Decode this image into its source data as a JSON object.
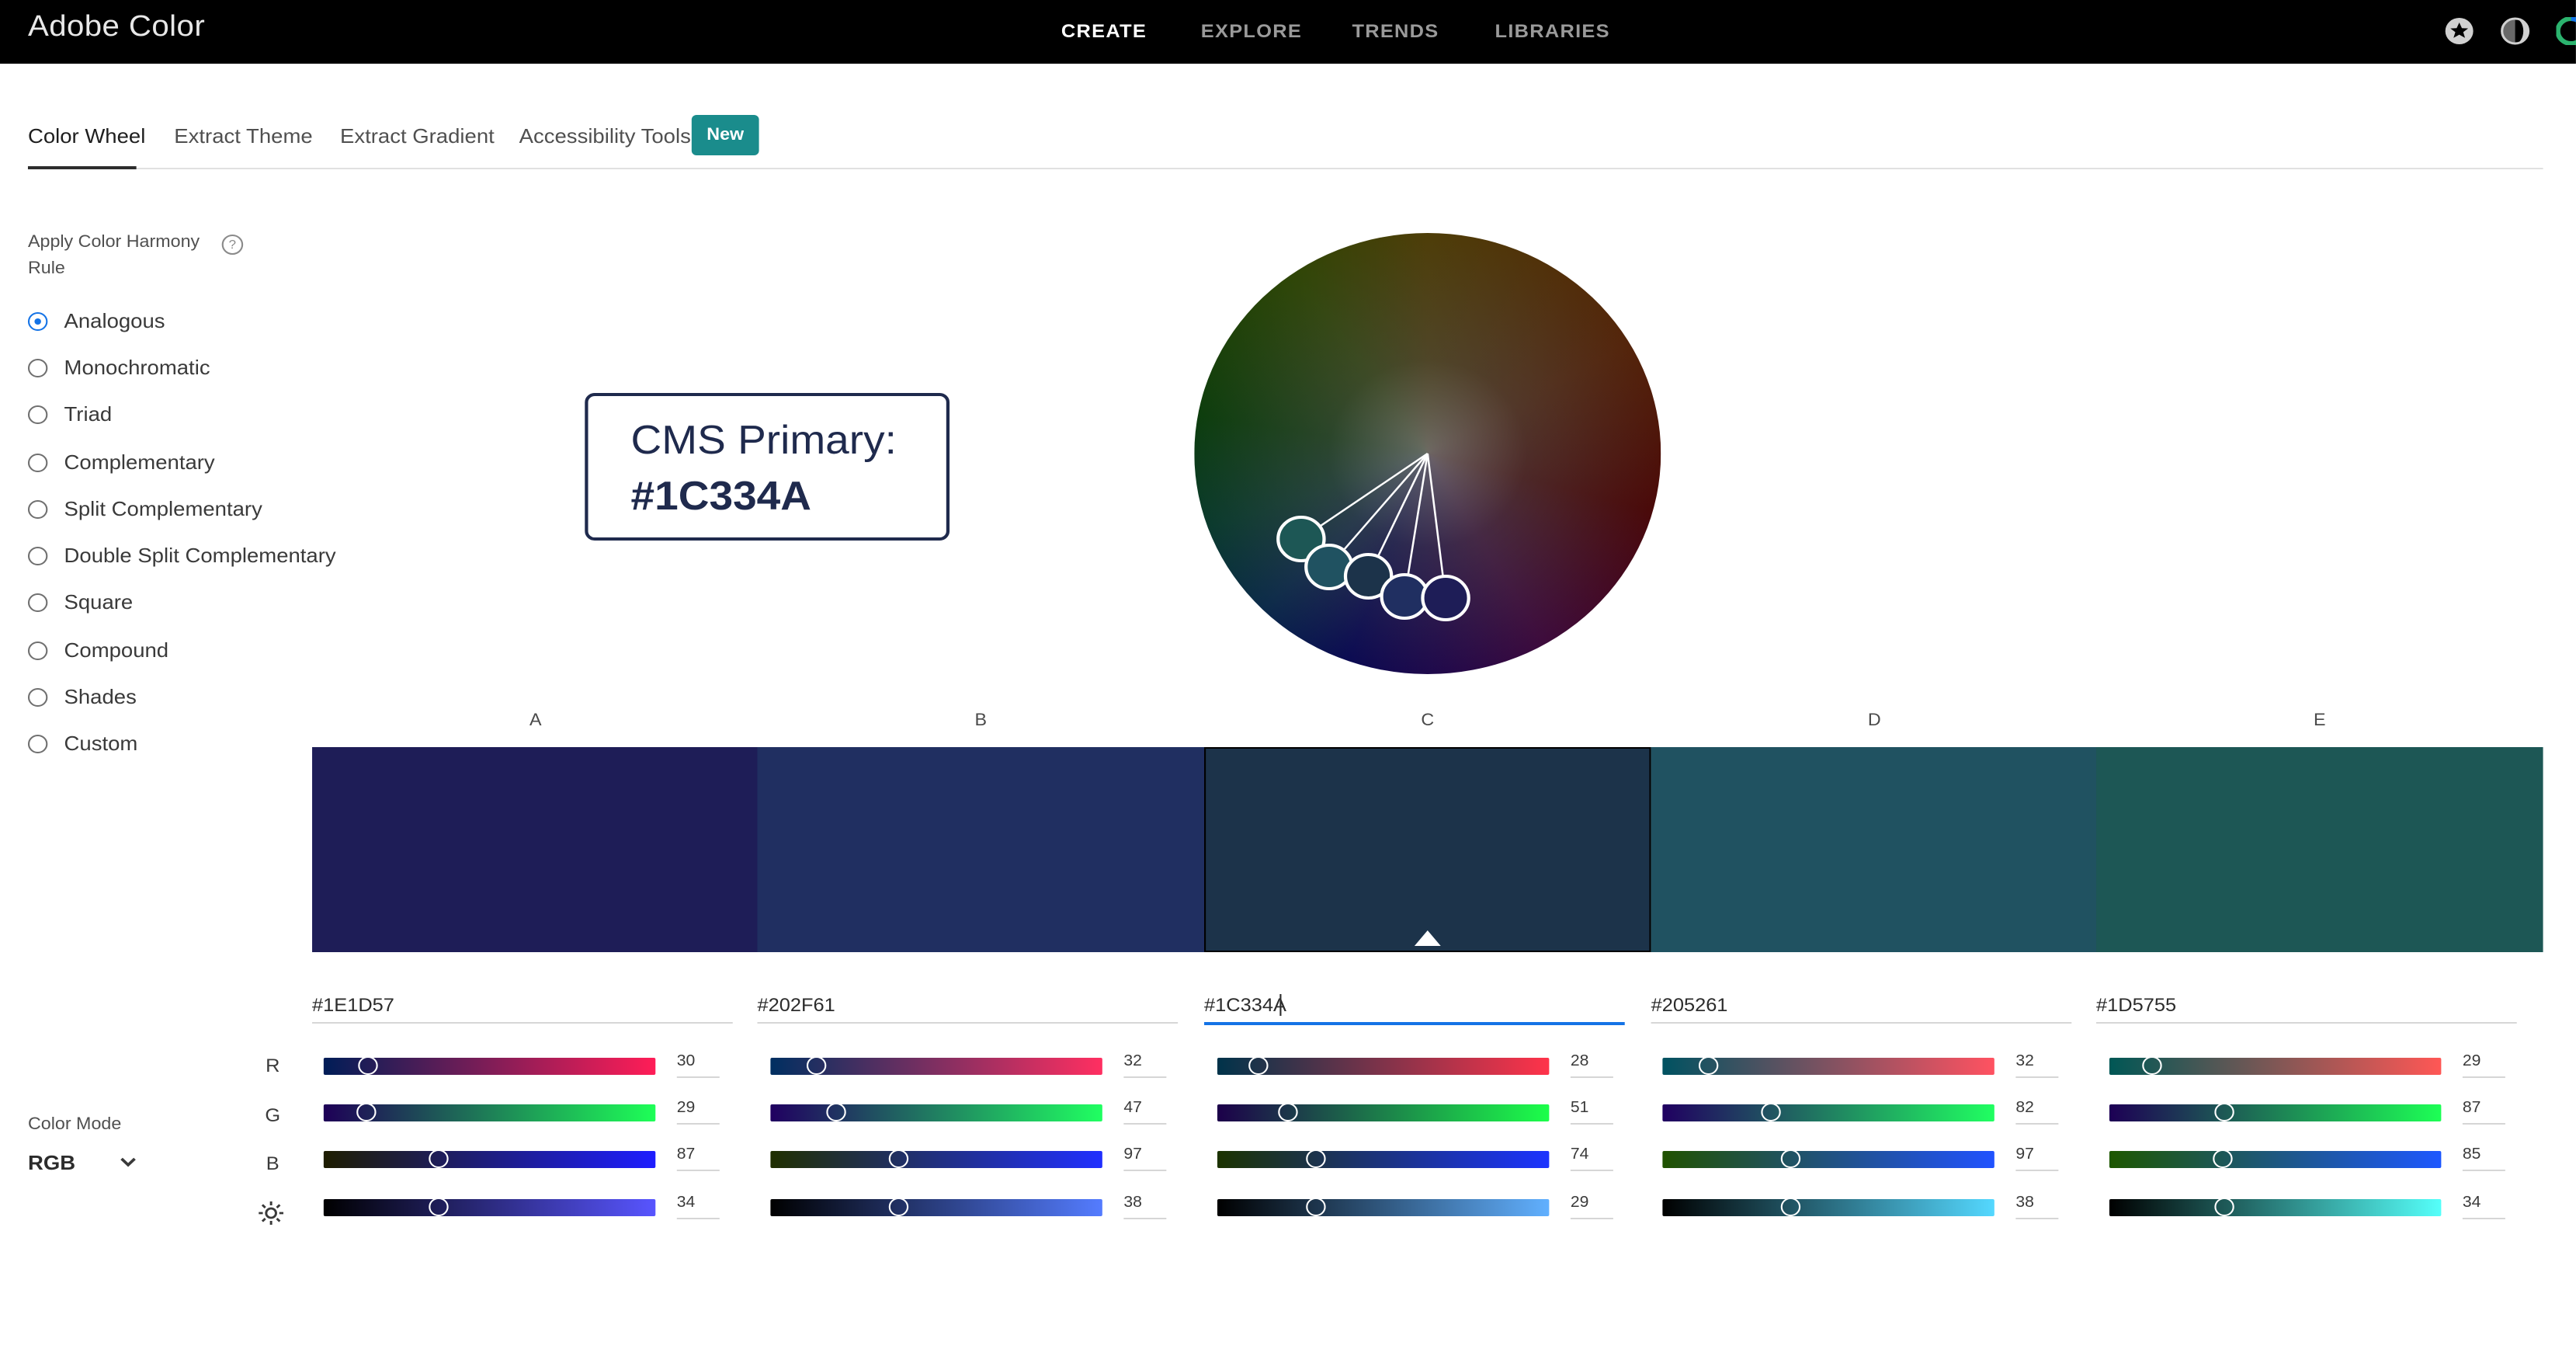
{
  "app": {
    "title": "Adobe Color"
  },
  "topnav": [
    "CREATE",
    "EXPLORE",
    "TRENDS",
    "LIBRARIES"
  ],
  "topnav_active": "CREATE",
  "header_icons": [
    "star-icon",
    "theme-toggle-icon",
    "user-avatar"
  ],
  "tabs": [
    "Color Wheel",
    "Extract Theme",
    "Extract Gradient",
    "Accessibility Tools"
  ],
  "tabs_active": "Color Wheel",
  "new_badge": "New",
  "harmony": {
    "label": "Apply Color Harmony Rule",
    "help_icon": "?",
    "selected": "Analogous",
    "rules": [
      "Analogous",
      "Monochromatic",
      "Triad",
      "Complementary",
      "Split Complementary",
      "Double Split Complementary",
      "Square",
      "Compound",
      "Shades",
      "Custom"
    ]
  },
  "callout": {
    "line1": "CMS Primary:",
    "line2": "#1C334A"
  },
  "swatches": [
    {
      "letter": "A",
      "hex": "#1E1D57",
      "color": "#1E1D57",
      "r": "30",
      "g": "29",
      "b": "87",
      "bright": "34"
    },
    {
      "letter": "B",
      "hex": "#202F61",
      "color": "#202F61",
      "r": "32",
      "g": "47",
      "b": "97",
      "bright": "38"
    },
    {
      "letter": "C",
      "hex": "#1C334A",
      "color": "#1C334A",
      "r": "28",
      "g": "51",
      "b": "74",
      "bright": "29"
    },
    {
      "letter": "D",
      "hex": "#205261",
      "color": "#205261",
      "r": "32",
      "g": "82",
      "b": "97",
      "bright": "38"
    },
    {
      "letter": "E",
      "hex": "#1D5755",
      "color": "#1D5755",
      "r": "29",
      "g": "87",
      "b": "85",
      "bright": "34"
    }
  ],
  "selected_swatch": "C",
  "channels": [
    "R",
    "G",
    "B"
  ],
  "brightness_icon": "brightness-icon",
  "color_mode": {
    "label": "Color Mode",
    "value": "RGB"
  }
}
